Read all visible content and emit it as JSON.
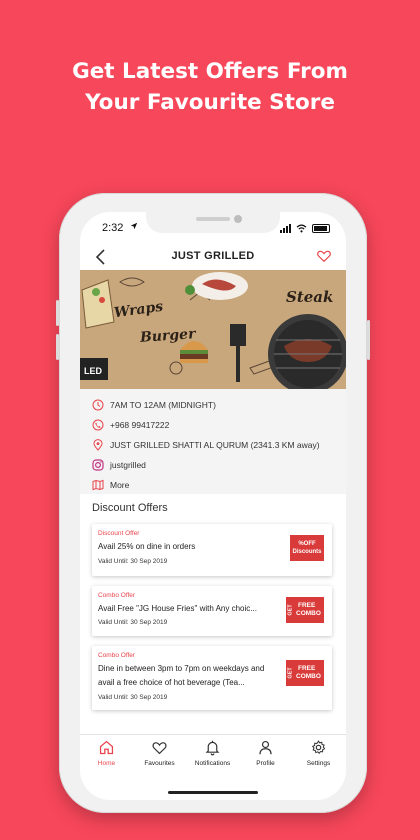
{
  "headline": {
    "line1": "Get Latest Offers From",
    "line2": "Your Favourite Store"
  },
  "status_bar": {
    "time": "2:32",
    "location_icon": "location-arrow-icon"
  },
  "header": {
    "title": "JUST GRILLED",
    "back_icon": "chevron-left-icon",
    "favourite_icon": "heart-outline-icon"
  },
  "banner": {
    "words": [
      "Wraps",
      "Burger",
      "Steak"
    ],
    "logo_text": "LED"
  },
  "store_info": {
    "hours": "7AM TO 12AM (MIDNIGHT)",
    "phone": "+968 99417222",
    "address": "JUST GRILLED SHATTI AL QURUM (2341.3 KM away)",
    "instagram": "justgrilled",
    "more": "More"
  },
  "offers_section": {
    "title": "Discount Offers",
    "offers": [
      {
        "type": "Discount Offer",
        "description": "Avail 25% on dine in orders",
        "valid": "Valid Until:  30 Sep 2019",
        "badge_line1": "%OFF",
        "badge_line2": "Discounts"
      },
      {
        "type": "Combo Offer",
        "description": "Avail Free \"JG House Fries\" with Any choic...",
        "valid": "Valid Until:  30 Sep 2019",
        "badge_line1": "FREE",
        "badge_line2": "COMBO",
        "badge_side": "GET"
      },
      {
        "type": "Combo Offer",
        "description": "Dine in between 3pm to 7pm on weekdays and avail a free choice of hot beverage (Tea...",
        "valid": "Valid Until:  30 Sep 2019",
        "badge_line1": "FREE",
        "badge_line2": "COMBO",
        "badge_side": "GET"
      }
    ]
  },
  "tab_bar": {
    "tabs": [
      {
        "label": "Home",
        "icon": "home-icon",
        "active": true
      },
      {
        "label": "Favourites",
        "icon": "heart-icon",
        "active": false
      },
      {
        "label": "Notifications",
        "icon": "bell-icon",
        "active": false
      },
      {
        "label": "Profile",
        "icon": "person-icon",
        "active": false
      },
      {
        "label": "Settings",
        "icon": "gear-icon",
        "active": false
      }
    ]
  },
  "colors": {
    "background": "#f7475a",
    "accent": "#e8444b",
    "badge": "#d93a3a"
  }
}
